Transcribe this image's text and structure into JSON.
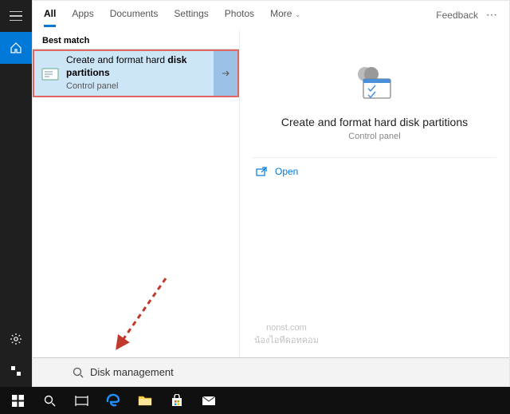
{
  "tabs": {
    "all": "All",
    "apps": "Apps",
    "documents": "Documents",
    "settings": "Settings",
    "photos": "Photos",
    "more": "More"
  },
  "header": {
    "feedback": "Feedback"
  },
  "section": {
    "best_match": "Best match"
  },
  "result": {
    "line1a": "Create and format hard ",
    "bold": "disk",
    "line2": "partitions",
    "sub": "Control panel"
  },
  "detail": {
    "title": "Create and format hard disk partitions",
    "sub": "Control panel",
    "open": "Open"
  },
  "search": {
    "query": "Disk management"
  },
  "watermark": {
    "l1": "nonst.com",
    "l2": "น้องไอทีดอทคอม"
  }
}
